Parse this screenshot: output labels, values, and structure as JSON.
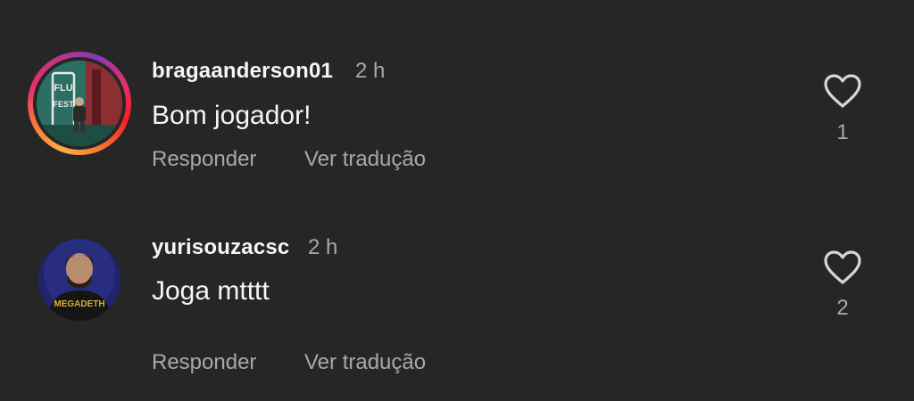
{
  "comments": [
    {
      "username": "bragaanderson01",
      "time": "2 h",
      "text": "Bom jogador!",
      "reply_label": "Responder",
      "translate_label": "Ver tradução",
      "likes": "1",
      "has_story_ring": true,
      "avatar_text": "FLU FEST"
    },
    {
      "username": "yurisouzacsc",
      "time": "2 h",
      "text": "Joga mtttt",
      "reply_label": "Responder",
      "translate_label": "Ver tradução",
      "likes": "2",
      "has_story_ring": false,
      "avatar_text": "MEGADETH"
    }
  ],
  "colors": {
    "background": "#262626",
    "primary_text": "#f5f5f5",
    "secondary_text": "#a8a8a8"
  },
  "icons": {
    "like": "heart-outline-icon"
  }
}
